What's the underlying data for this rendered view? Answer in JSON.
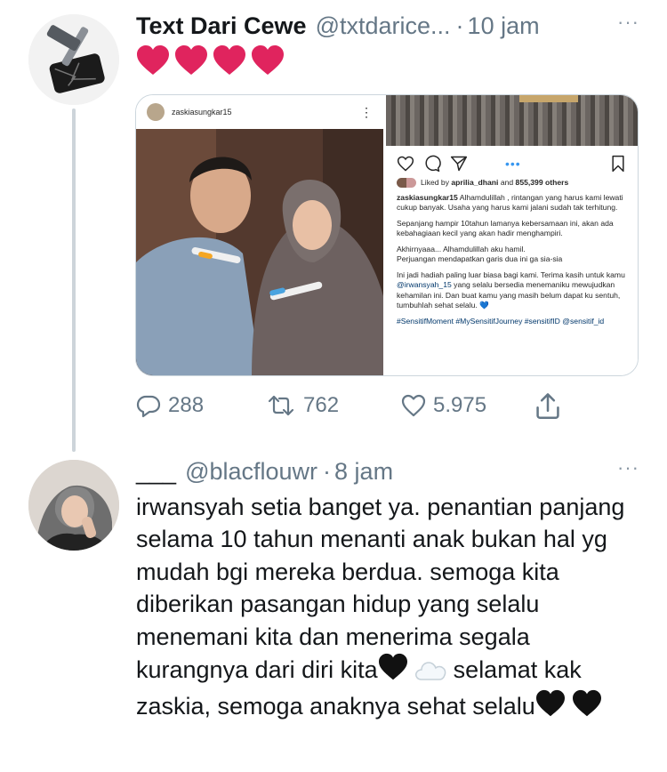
{
  "tweet": {
    "display_name": "Text Dari Cewe",
    "handle": "@txtdarice...",
    "separator": "·",
    "time": "10 jam",
    "more": "···",
    "hearts_emoji": "❤️❤️❤️❤️",
    "media": {
      "left_panel": {
        "username": "zaskiasungkar15",
        "menu": "⋮"
      },
      "right_panel": {
        "carousel_dots": "•••",
        "liked_by_prefix": "Liked by",
        "liked_by_user": "aprilia_dhani",
        "liked_by_suffix": "and",
        "liked_by_count": "855,399 others",
        "caption_user": "zaskiasungkar15",
        "caption_p1": "Alhamdulillah , rintangan yang harus kami lewati cukup banyak. Usaha yang harus kami jalani sudah tak terhitung.",
        "caption_p2": "Sepanjang hampir 10tahun lamanya kebersamaan ini, akan ada kebahagiaan kecil yang akan hadir menghampiri.",
        "caption_p3_line1": "Akhirnyaaa... Alhamdulillah aku hamil.",
        "caption_p3_line2": "Perjuangan mendapatkan garis dua ini ga sia-sia",
        "caption_p4_part1": "Ini jadi hadiah paling luar biasa bagi kami. Terima kasih untuk kamu",
        "caption_p4_mention": "@irwansyah_15",
        "caption_p4_part2": "yang selalu bersedia menemaniku mewujudkan kehamilan ini. Dan buat kamu yang masih belum dapat ku sentuh, tumbuhlah sehat selalu. 💙",
        "caption_tags": "#SensitifMoment #MySensitifJourney #sensitifID @sensitif_id"
      }
    },
    "stats": {
      "replies": "288",
      "retweets": "762",
      "likes": "5.975"
    }
  },
  "reply": {
    "display_name": "___",
    "handle": "@blacflouwr",
    "separator": "·",
    "time": "8 jam",
    "more": "···",
    "text_before_heart": "irwansyah setia banget ya. penantian panjang selama 10 tahun menanti anak bukan hal yg mudah bgi mereka berdua. semoga kita diberikan pasangan hidup yang selalu menemani kita dan menerima segala kurangnya dari diri kita",
    "text_after_emoji": "selamat kak zaskia, semoga anaknya sehat selalu",
    "emoji_black_heart": "🖤",
    "emoji_cloud": "☁️"
  },
  "colors": {
    "heart_red": "#e0245e",
    "secondary_text": "#657786",
    "thread_line": "#cdd4da"
  }
}
